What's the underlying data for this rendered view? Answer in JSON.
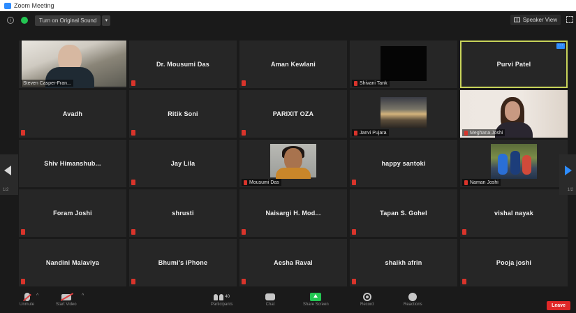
{
  "window": {
    "title": "Zoom Meeting"
  },
  "topbar": {
    "original_sound_label": "Turn on Original Sound",
    "view_label": "Speaker View"
  },
  "participants": [
    {
      "name": "Steven Casper",
      "display": "video",
      "label": "Steven Casper-Fran..."
    },
    {
      "name": "Dr. Mousumi Das",
      "display": "name"
    },
    {
      "name": "Aman Kewlani",
      "display": "name"
    },
    {
      "name": "Shivani Tank",
      "display": "video",
      "label": "Shivani Tank"
    },
    {
      "name": "Purvi Patel",
      "display": "name",
      "active": true
    },
    {
      "name": "Avadh",
      "display": "name"
    },
    {
      "name": "Ritik Soni",
      "display": "name"
    },
    {
      "name": "PARIXIT OZA",
      "display": "name"
    },
    {
      "name": "Janvi Pujara",
      "display": "video",
      "label": "Janvi Pujara"
    },
    {
      "name": "Meghana Joshi",
      "display": "video",
      "label": "Meghana Joshi"
    },
    {
      "name": "Shiv Himanshub...",
      "display": "name"
    },
    {
      "name": "Jay Lila",
      "display": "name"
    },
    {
      "name": "Mousumi Das",
      "display": "video",
      "label": "Mousumi Das"
    },
    {
      "name": "happy santoki",
      "display": "name"
    },
    {
      "name": "Naman Joshi",
      "display": "video",
      "label": "Naman Joshi"
    },
    {
      "name": "Foram Joshi",
      "display": "name"
    },
    {
      "name": "shrusti",
      "display": "name"
    },
    {
      "name": "Naisargi H. Mod...",
      "display": "name"
    },
    {
      "name": "Tapan S. Gohel",
      "display": "name"
    },
    {
      "name": "vishal nayak",
      "display": "name"
    },
    {
      "name": "Nandini Malaviya",
      "display": "name"
    },
    {
      "name": "Bhumi's iPhone",
      "display": "name"
    },
    {
      "name": "Aesha Raval",
      "display": "name"
    },
    {
      "name": "shaikh afrin",
      "display": "name"
    },
    {
      "name": "Pooja joshi",
      "display": "name"
    }
  ],
  "pagination": {
    "left": "1/2",
    "right": "1/2"
  },
  "toolbar": {
    "unmute": "Unmute",
    "start_video": "Start Video",
    "participants": "Participants",
    "participants_count": "40",
    "chat": "Chat",
    "share_screen": "Share Screen",
    "record": "Record",
    "reactions": "Reactions",
    "leave": "Leave"
  },
  "colors": {
    "background": "#1a1a1a",
    "tile": "#262626",
    "active_speaker_border": "#c8d35a",
    "muted_red": "#d9342b",
    "accent_blue": "#2d8cff",
    "share_green": "#23c552",
    "leave_red": "#e02828"
  }
}
